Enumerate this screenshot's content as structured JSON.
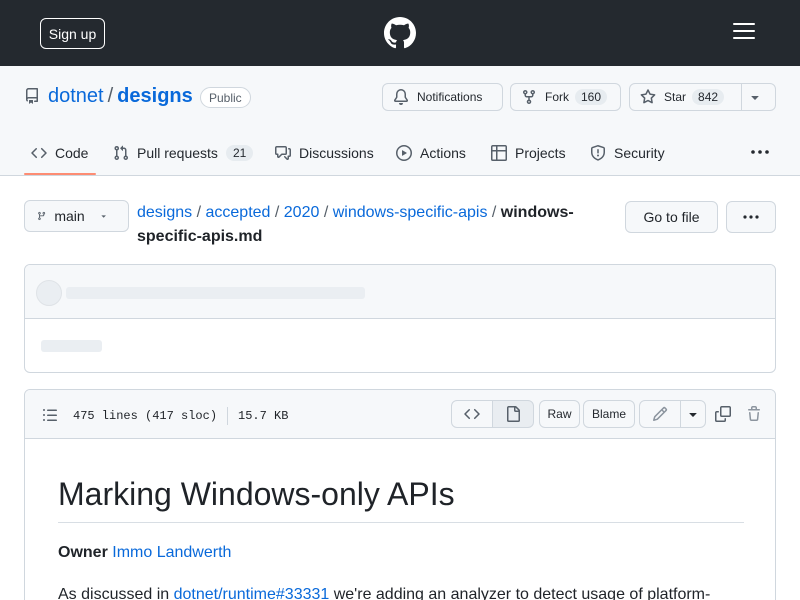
{
  "header": {
    "signup_label": "Sign up",
    "logo_icon": "github-mark-icon",
    "menu_icon": "hamburger-icon"
  },
  "repo": {
    "owner": "dotnet",
    "separator": "/",
    "name": "designs",
    "visibility": "Public",
    "notifications_label": "Notifications",
    "fork_label": "Fork",
    "fork_count": "160",
    "star_label": "Star",
    "star_count": "842"
  },
  "tabs": [
    {
      "label": "Code",
      "icon": "code-icon"
    },
    {
      "label": "Pull requests",
      "icon": "pull-request-icon",
      "count": "21"
    },
    {
      "label": "Discussions",
      "icon": "discussions-icon"
    },
    {
      "label": "Actions",
      "icon": "play-icon"
    },
    {
      "label": "Projects",
      "icon": "table-icon"
    },
    {
      "label": "Security",
      "icon": "shield-icon"
    }
  ],
  "file_nav": {
    "branch": "main",
    "path": [
      "designs",
      "accepted",
      "2020",
      "windows-specific-apis"
    ],
    "filename": "windows-specific-apis.md",
    "goto_label": "Go to file"
  },
  "file": {
    "lines": "475 lines (417 sloc)",
    "size": "15.7 KB",
    "raw_label": "Raw",
    "blame_label": "Blame"
  },
  "readme": {
    "title": "Marking Windows-only APIs",
    "owner_label": "Owner",
    "owner_name": "Immo Landwerth",
    "para_prefix": "As discussed in ",
    "para_link": "dotnet/runtime#33331",
    "para_suffix": " we're adding an analyzer to detect usage of platform-"
  },
  "colors": {
    "header_bg": "#24292f",
    "link": "#0969da",
    "tab_underline": "#fd8c73",
    "border": "#d0d7de"
  }
}
